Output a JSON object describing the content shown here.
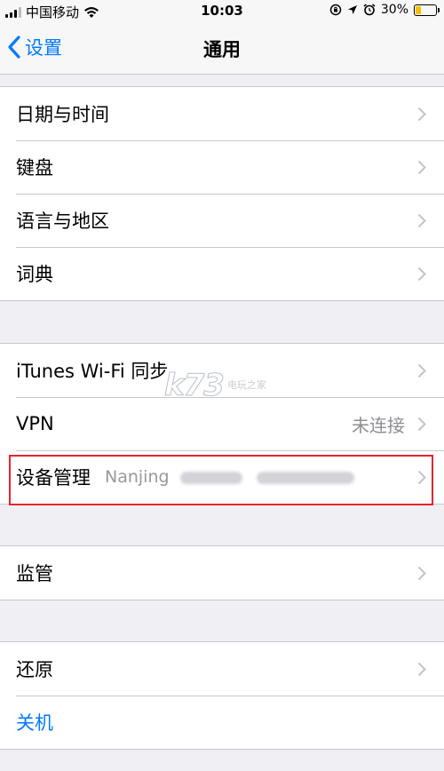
{
  "status_bar": {
    "carrier": "中国移动",
    "time": "10:03",
    "battery_percent": "30%",
    "battery_level": 0.3
  },
  "nav": {
    "back_label": "设置",
    "title": "通用"
  },
  "group1": {
    "items": [
      {
        "label": "日期与时间"
      },
      {
        "label": "键盘"
      },
      {
        "label": "语言与地区"
      },
      {
        "label": "词典"
      }
    ]
  },
  "group2": {
    "items": [
      {
        "label": "iTunes Wi-Fi 同步",
        "detail": ""
      },
      {
        "label": "VPN",
        "detail": "未连接"
      },
      {
        "label": "设备管理",
        "detail": "Nanjing"
      }
    ]
  },
  "group3": {
    "items": [
      {
        "label": "监管"
      }
    ]
  },
  "group4": {
    "items": [
      {
        "label": "还原"
      },
      {
        "label": "关机"
      }
    ]
  },
  "watermark": {
    "logo": "k73",
    "text": "电玩之家"
  },
  "colors": {
    "accent": "#007aff",
    "highlight": "#e8242b",
    "background": "#efeff4",
    "battery": "#f5c000"
  }
}
